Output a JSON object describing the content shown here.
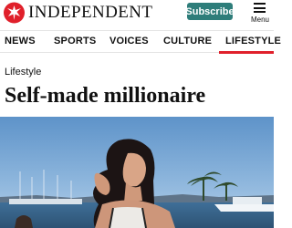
{
  "header": {
    "logo_text": "INDEPENDENT",
    "subscribe_label": "Subscribe",
    "menu_label": "Menu"
  },
  "nav": {
    "items": [
      "NEWS",
      "SPORTS",
      "VOICES",
      "CULTURE",
      "LIFESTYLE"
    ],
    "active": "LIFESTYLE"
  },
  "article": {
    "section": "Lifestyle",
    "headline": "Self-made millionaire"
  },
  "colors": {
    "accent_red": "#e0202b",
    "subscribe_green": "#2e7d7a"
  },
  "icons": {
    "logo": "eagle-logo-icon",
    "menu": "hamburger-menu-icon"
  }
}
